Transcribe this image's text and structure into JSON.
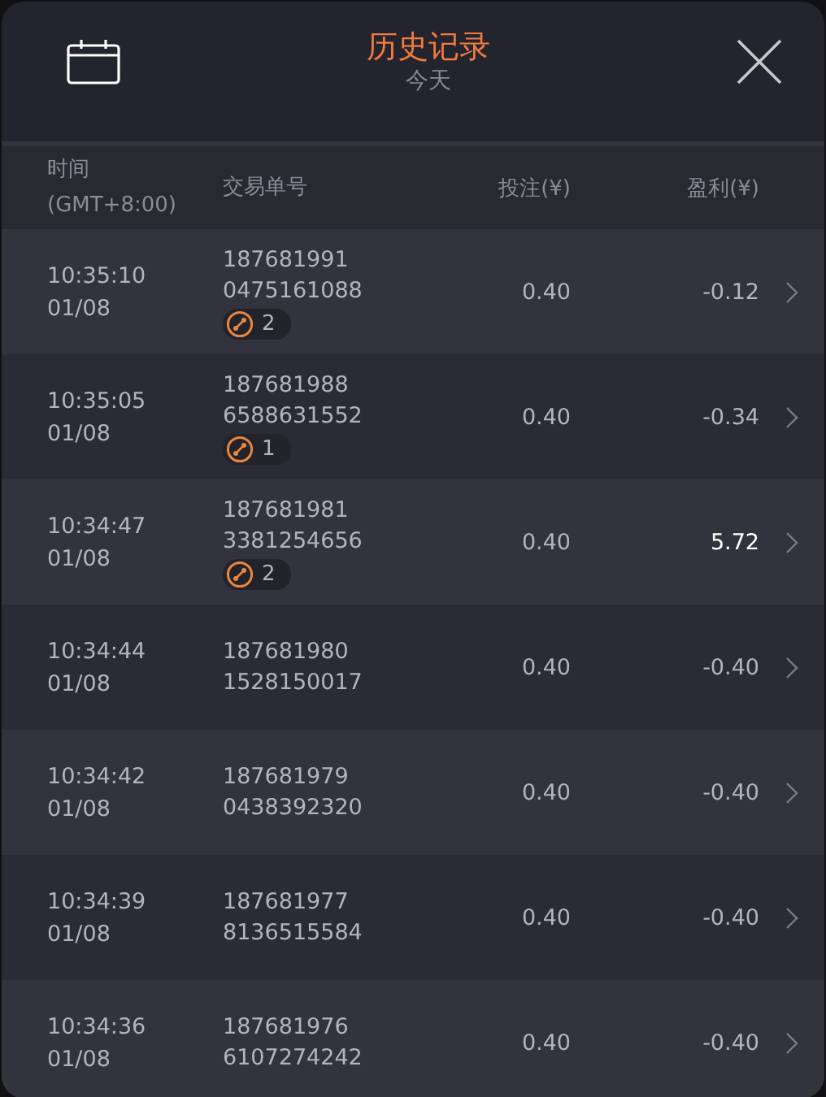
{
  "header": {
    "title": "历史记录",
    "subtitle": "今天"
  },
  "columns": {
    "time": "时间",
    "time_zone": "(GMT+8:00)",
    "order": "交易单号",
    "stake": "投注(¥)",
    "profit": "盈利(¥)"
  },
  "rows": [
    {
      "time": "10:35:10",
      "date": "01/08",
      "order_1": "187681991",
      "order_2": "0475161088",
      "badge": "2",
      "stake": "0.40",
      "profit": "-0.12",
      "positive": false
    },
    {
      "time": "10:35:05",
      "date": "01/08",
      "order_1": "187681988",
      "order_2": "6588631552",
      "badge": "1",
      "stake": "0.40",
      "profit": "-0.34",
      "positive": false
    },
    {
      "time": "10:34:47",
      "date": "01/08",
      "order_1": "187681981",
      "order_2": "3381254656",
      "badge": "2",
      "stake": "0.40",
      "profit": "5.72",
      "positive": true
    },
    {
      "time": "10:34:44",
      "date": "01/08",
      "order_1": "187681980",
      "order_2": "1528150017",
      "stake": "0.40",
      "profit": "-0.40",
      "positive": false
    },
    {
      "time": "10:34:42",
      "date": "01/08",
      "order_1": "187681979",
      "order_2": "0438392320",
      "stake": "0.40",
      "profit": "-0.40",
      "positive": false
    },
    {
      "time": "10:34:39",
      "date": "01/08",
      "order_1": "187681977",
      "order_2": "8136515584",
      "stake": "0.40",
      "profit": "-0.40",
      "positive": false
    },
    {
      "time": "10:34:36",
      "date": "01/08",
      "order_1": "187681976",
      "order_2": "6107274242",
      "stake": "0.40",
      "profit": "-0.40",
      "positive": false
    }
  ]
}
